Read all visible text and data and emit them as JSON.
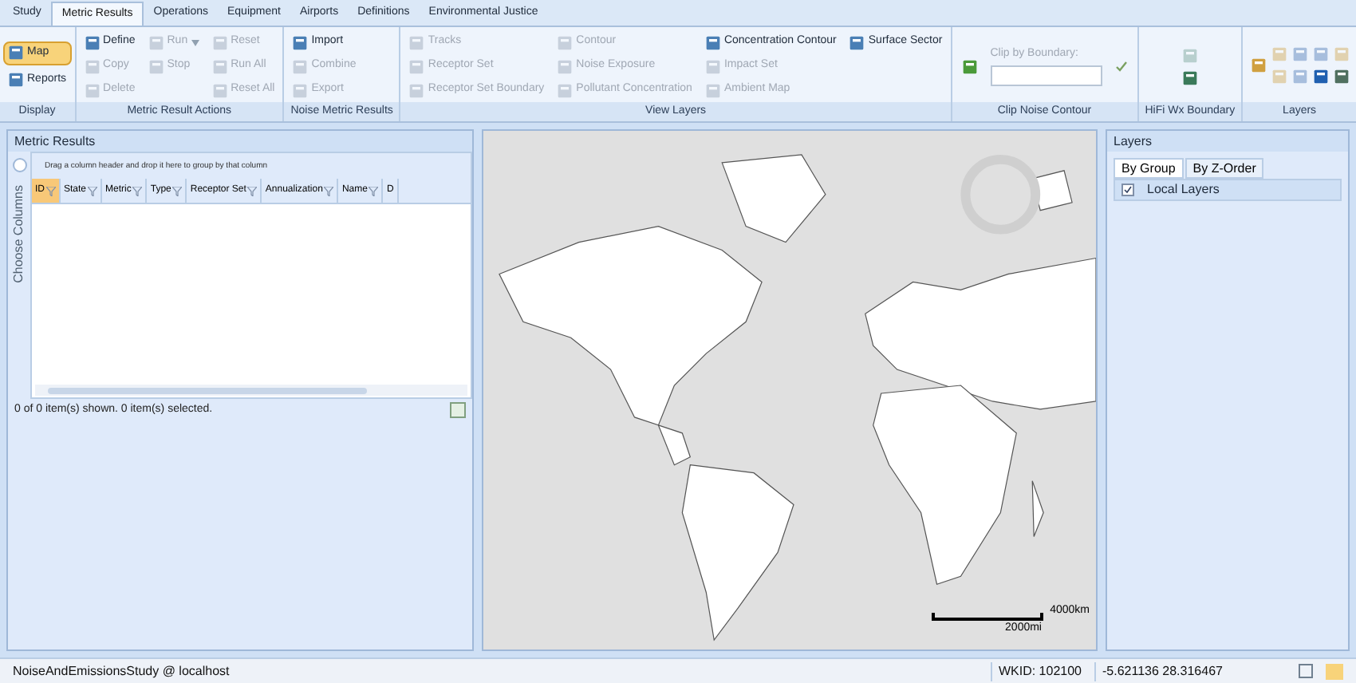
{
  "tabs": [
    {
      "label": "Study",
      "selected": false
    },
    {
      "label": "Metric Results",
      "selected": true
    },
    {
      "label": "Operations",
      "selected": false
    },
    {
      "label": "Equipment",
      "selected": false
    },
    {
      "label": "Airports",
      "selected": false
    },
    {
      "label": "Definitions",
      "selected": false
    },
    {
      "label": "Environmental Justice",
      "selected": false
    }
  ],
  "ribbon": [
    {
      "title": "Display",
      "columns": [
        [
          {
            "label": "Map",
            "disabled": false,
            "selected": true
          },
          {
            "label": "Reports",
            "disabled": false,
            "selected": false
          }
        ]
      ]
    },
    {
      "title": "Metric Result Actions",
      "columns": [
        [
          {
            "label": "Define",
            "disabled": false,
            "selected": false
          },
          {
            "label": "Copy",
            "disabled": true,
            "selected": false
          },
          {
            "label": "Delete",
            "disabled": true,
            "selected": false
          }
        ],
        [
          {
            "label": "Run",
            "disabled": true,
            "selected": false,
            "dropdown": true
          },
          {
            "label": "Stop",
            "disabled": true,
            "selected": false
          }
        ],
        [
          {
            "label": "Reset",
            "disabled": true,
            "selected": false
          },
          {
            "label": "Run All",
            "disabled": true,
            "selected": false
          },
          {
            "label": "Reset All",
            "disabled": true,
            "selected": false
          }
        ]
      ]
    },
    {
      "title": "Noise Metric Results",
      "columns": [
        [
          {
            "label": "Import",
            "disabled": false,
            "selected": false
          },
          {
            "label": "Combine",
            "disabled": true,
            "selected": false
          },
          {
            "label": "Export",
            "disabled": true,
            "selected": false
          }
        ]
      ]
    },
    {
      "title": "View Layers",
      "columns": [
        [
          {
            "label": "Tracks",
            "disabled": true,
            "selected": false
          },
          {
            "label": "Receptor Set",
            "disabled": true,
            "selected": false
          },
          {
            "label": "Receptor Set Boundary",
            "disabled": true,
            "selected": false
          }
        ],
        [
          {
            "label": "Contour",
            "disabled": true,
            "selected": false
          },
          {
            "label": "Noise Exposure",
            "disabled": true,
            "selected": false
          },
          {
            "label": "Pollutant Concentration",
            "disabled": true,
            "selected": false
          }
        ],
        [
          {
            "label": "Concentration Contour",
            "disabled": false,
            "selected": false
          },
          {
            "label": "Impact Set",
            "disabled": true,
            "selected": false
          },
          {
            "label": "Ambient Map",
            "disabled": true,
            "selected": false
          }
        ],
        [
          {
            "label": "Surface Sector",
            "disabled": false,
            "selected": false
          }
        ]
      ]
    }
  ],
  "clip": {
    "title": "Clip Noise Contour",
    "label": "Clip by Boundary:"
  },
  "hifi": {
    "title": "HiFi Wx Boundary"
  },
  "layers_group": {
    "title": "Layers"
  },
  "metric_panel": {
    "title": "Metric Results",
    "side_label": "Choose Columns",
    "group_hint": "Drag a column header and drop it here to group by that column",
    "columns": [
      {
        "label": "ID",
        "selected": true
      },
      {
        "label": "State",
        "selected": false
      },
      {
        "label": "Metric",
        "selected": false
      },
      {
        "label": "Type",
        "selected": false
      },
      {
        "label": "Receptor Set",
        "selected": false
      },
      {
        "label": "Annualization",
        "selected": false
      },
      {
        "label": "Name",
        "selected": false
      },
      {
        "label": "D",
        "selected": false
      }
    ],
    "footer": "0 of 0 item(s) shown. 0 item(s) selected."
  },
  "map": {
    "scale_km": "4000km",
    "scale_mi": "2000mi"
  },
  "layers_panel": {
    "title": "Layers",
    "tabs": [
      {
        "label": "By Group",
        "selected": true
      },
      {
        "label": "By Z-Order",
        "selected": false
      }
    ],
    "items": [
      {
        "label": "Local Layers",
        "checked": true
      }
    ]
  },
  "status_bar": {
    "study": "NoiseAndEmissionsStudy @ localhost",
    "wkid": "WKID: 102100",
    "coords": "-5.621136 28.316467"
  }
}
